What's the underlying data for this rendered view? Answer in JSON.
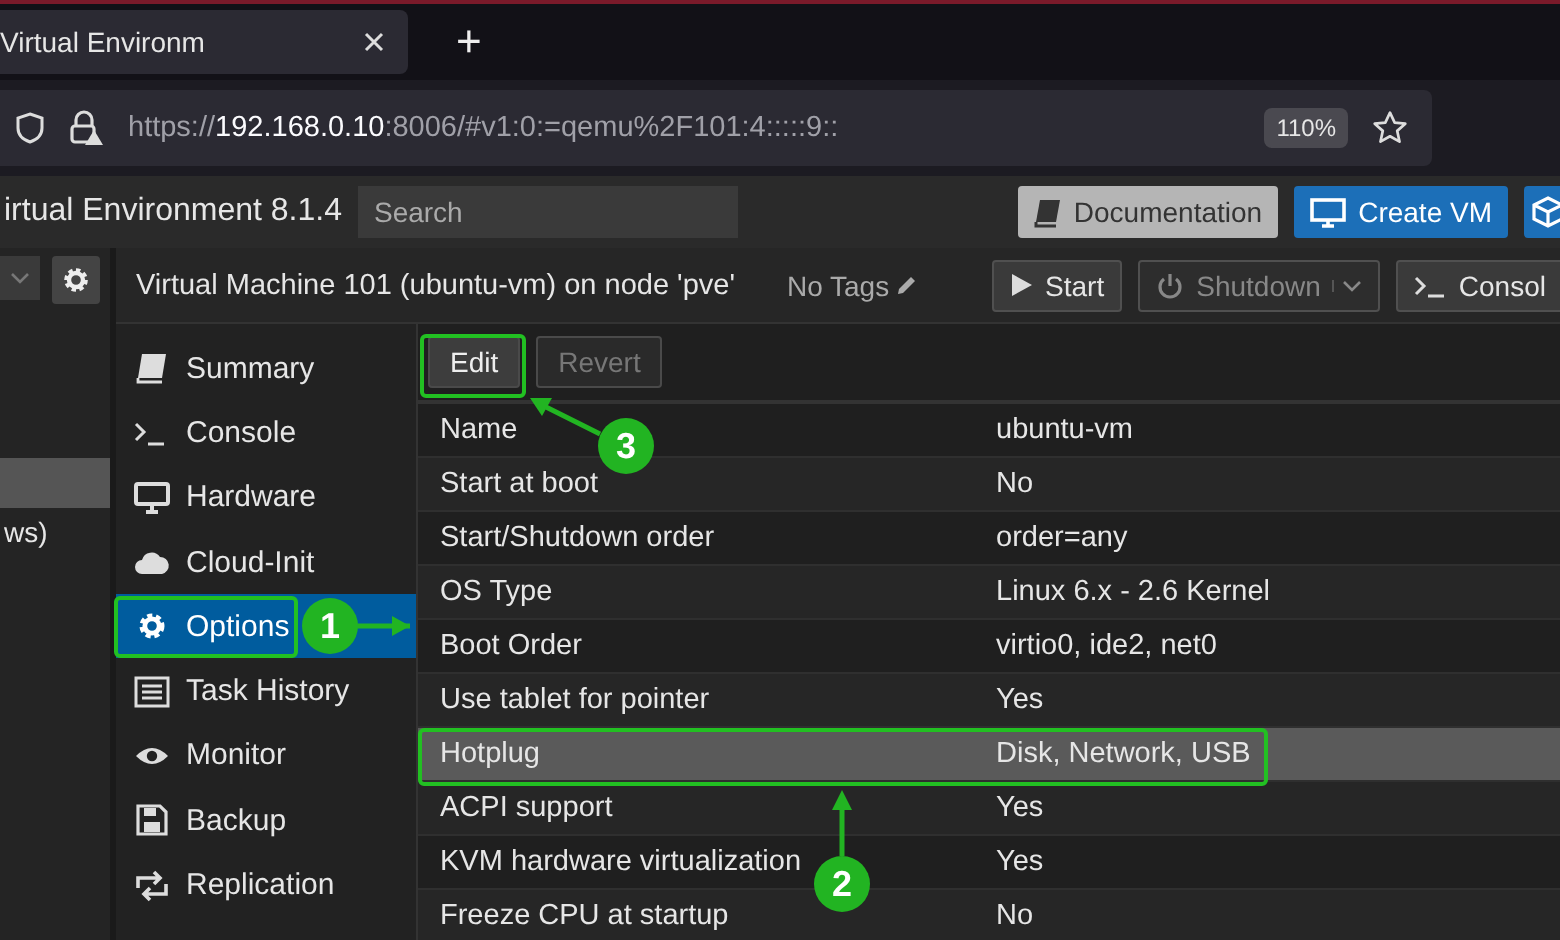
{
  "browser": {
    "tab_title": "Virtual Environm",
    "new_tab": "+",
    "url": {
      "scheme": "https://",
      "host": "192.168.0.10",
      "rest": ":8006/#v1:0:=qemu%2F101:4:::::9::"
    },
    "zoom": "110%"
  },
  "header": {
    "title": "irtual Environment 8.1.4",
    "search": {
      "placeholder": "Search"
    },
    "buttons": [
      {
        "label": "Documentation",
        "kind": "doc"
      },
      {
        "label": "Create VM",
        "kind": "primary"
      }
    ]
  },
  "tree": {
    "items": [
      {
        "selected": true
      },
      {
        "label": "ws)",
        "selected": false
      }
    ]
  },
  "vm_header": {
    "title": "Virtual Machine 101 (ubuntu-vm) on node 'pve'",
    "tags": "No Tags",
    "buttons": [
      {
        "label": "Start",
        "kind": "start",
        "disabled": false
      },
      {
        "label": "Shutdown",
        "kind": "shutdown",
        "disabled": true
      },
      {
        "label": "Consol",
        "kind": "console",
        "disabled": false
      }
    ]
  },
  "nav": [
    {
      "label": "Summary",
      "selected": false
    },
    {
      "label": "Console",
      "selected": false
    },
    {
      "label": "Hardware",
      "selected": false
    },
    {
      "label": "Cloud-Init",
      "selected": false
    },
    {
      "label": "Options",
      "selected": true
    },
    {
      "label": "Task History",
      "selected": false
    },
    {
      "label": "Monitor",
      "selected": false
    },
    {
      "label": "Backup",
      "selected": false
    },
    {
      "label": "Replication",
      "selected": false
    }
  ],
  "toolbar": [
    {
      "label": "Edit",
      "disabled": false
    },
    {
      "label": "Revert",
      "disabled": true
    }
  ],
  "options": [
    {
      "name": "Name",
      "value": "ubuntu-vm",
      "selected": false
    },
    {
      "name": "Start at boot",
      "value": "No",
      "selected": false
    },
    {
      "name": "Start/Shutdown order",
      "value": "order=any",
      "selected": false
    },
    {
      "name": "OS Type",
      "value": "Linux 6.x - 2.6 Kernel",
      "selected": false
    },
    {
      "name": "Boot Order",
      "value": "virtio0, ide2, net0",
      "selected": false
    },
    {
      "name": "Use tablet for pointer",
      "value": "Yes",
      "selected": false
    },
    {
      "name": "Hotplug",
      "value": "Disk, Network, USB",
      "selected": true
    },
    {
      "name": "ACPI support",
      "value": "Yes",
      "selected": false
    },
    {
      "name": "KVM hardware virtualization",
      "value": "Yes",
      "selected": false
    },
    {
      "name": "Freeze CPU at startup",
      "value": "No",
      "selected": false
    }
  ],
  "annotations": [
    {
      "label": "1"
    },
    {
      "label": "2"
    },
    {
      "label": "3"
    }
  ]
}
